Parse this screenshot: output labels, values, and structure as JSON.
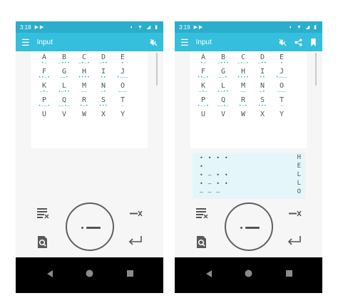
{
  "colors": {
    "status_bar": "#2aaecb",
    "app_bar": "#35bfdc",
    "morse_code": "#2aaecb",
    "output_bg": "#e5f6fb",
    "nav_bar": "#000000"
  },
  "letters": [
    {
      "ch": "A",
      "code": "•—"
    },
    {
      "ch": "B",
      "code": "—•••"
    },
    {
      "ch": "C",
      "code": "—•—•"
    },
    {
      "ch": "D",
      "code": "—••"
    },
    {
      "ch": "E",
      "code": "•"
    },
    {
      "ch": "F",
      "code": "••—•"
    },
    {
      "ch": "G",
      "code": "——•"
    },
    {
      "ch": "H",
      "code": "••••"
    },
    {
      "ch": "I",
      "code": "••"
    },
    {
      "ch": "J",
      "code": "•———"
    },
    {
      "ch": "K",
      "code": "—•—"
    },
    {
      "ch": "L",
      "code": "•—••"
    },
    {
      "ch": "M",
      "code": "——"
    },
    {
      "ch": "N",
      "code": "—•"
    },
    {
      "ch": "O",
      "code": "———"
    },
    {
      "ch": "P",
      "code": "•——•"
    },
    {
      "ch": "Q",
      "code": "——•—"
    },
    {
      "ch": "R",
      "code": "•—•"
    },
    {
      "ch": "S",
      "code": "•••"
    },
    {
      "ch": "T",
      "code": "—"
    },
    {
      "ch": "U",
      "code": ""
    },
    {
      "ch": "V",
      "code": ""
    },
    {
      "ch": "W",
      "code": ""
    },
    {
      "ch": "X",
      "code": ""
    },
    {
      "ch": "Y",
      "code": ""
    }
  ],
  "screens": {
    "left": {
      "status": {
        "time": "3:18",
        "notif": "▶ ▶",
        "right_icons": "◐ ▼ ◢ ▮"
      },
      "appbar": {
        "menu_icon": "menu-icon",
        "title": "Input",
        "actions": [
          "sound-off-icon"
        ]
      }
    },
    "right": {
      "status": {
        "time": "3:19",
        "notif": "▶ ▶",
        "right_icons": "◐ ▼ ◢ ▮"
      },
      "appbar": {
        "menu_icon": "menu-icon",
        "title": "Input",
        "actions": [
          "sound-off-icon",
          "share-icon",
          "bookmark-icon"
        ]
      },
      "output": [
        {
          "code": "• • • •",
          "char": "H"
        },
        {
          "code": "•",
          "char": "E"
        },
        {
          "code": "• — • •",
          "char": "L"
        },
        {
          "code": "• — • •",
          "char": "L"
        },
        {
          "code": "— — —",
          "char": "O"
        }
      ]
    }
  },
  "keypad": {
    "clear_all_icon": "clear-all-icon",
    "dial_icon": "morse-key-icon",
    "delete_icon": "backspace-x-icon",
    "lookup_icon": "file-search-icon",
    "enter_icon": "enter-arrow-icon"
  },
  "navbar": {
    "back_icon": "back-triangle-icon",
    "home_icon": "home-circle-icon",
    "recents_icon": "recents-square-icon"
  }
}
